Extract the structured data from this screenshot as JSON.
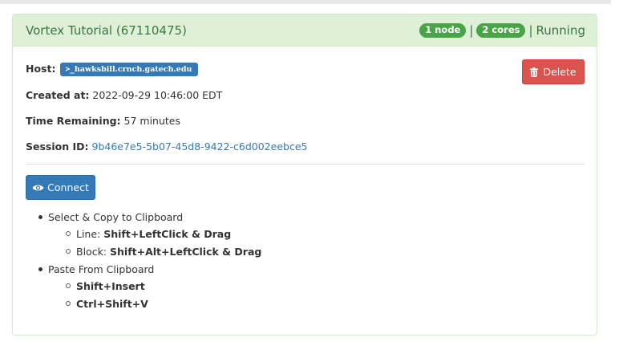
{
  "session": {
    "title": "Vortex Tutorial (67110475)",
    "nodes_badge": "1 node",
    "cores_badge": "2 cores",
    "separator": "|",
    "status": "Running",
    "host_label": "Host:",
    "host_prompt": ">_",
    "host_value": "hawksbill.crnch.gatech.edu",
    "created_label": "Created at:",
    "created_value": "2022-09-29 10:46:00 EDT",
    "remaining_label": "Time Remaining:",
    "remaining_value": "57 minutes",
    "session_id_label": "Session ID:",
    "session_id_value": "9b46e7e5-5b07-45d8-9422-c6d002eebce5"
  },
  "actions": {
    "delete_label": "Delete",
    "connect_label": "Connect"
  },
  "tips": {
    "copy_heading": "Select & Copy to Clipboard",
    "line_label": "Line:",
    "line_keys": "Shift+LeftClick & Drag",
    "block_label": "Block:",
    "block_keys": "Shift+Alt+LeftClick & Drag",
    "paste_heading": "Paste From Clipboard",
    "paste_key_1": "Shift+Insert",
    "paste_key_2": "Ctrl+Shift+V"
  },
  "colors": {
    "panel_heading_bg": "#dff0d8",
    "panel_heading_text": "#3c763d",
    "badge_success": "#47a447",
    "primary": "#337ab7",
    "danger": "#d9534f"
  },
  "icons": {
    "delete": "trash-icon",
    "connect": "eye-icon",
    "host": "terminal-icon"
  }
}
